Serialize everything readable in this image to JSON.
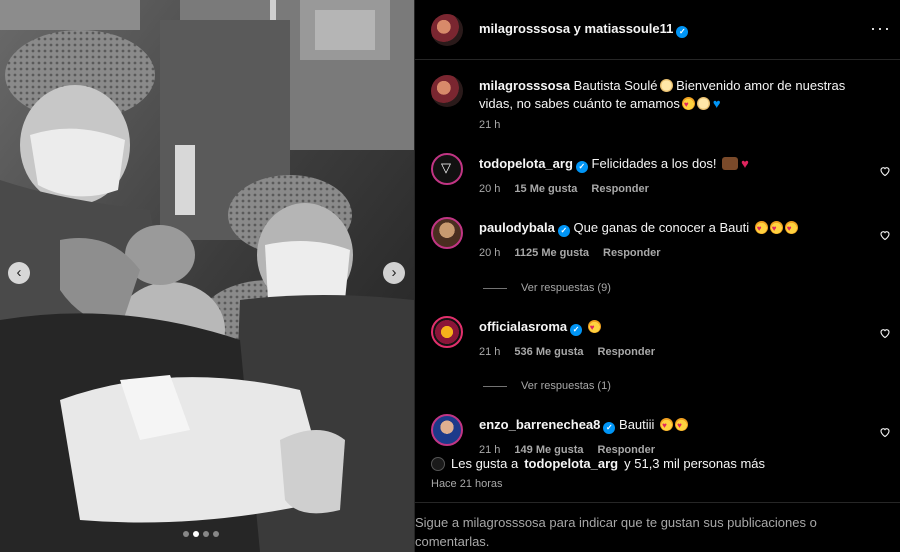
{
  "header": {
    "names": "milagrosssosa y matiassoule11"
  },
  "caption": {
    "user": "milagrosssosa",
    "text_a": "Bautista Soulé",
    "text_b": "Bienvenido amor de nuestras vidas, no sabes cuánto te amamos",
    "time": "21 h"
  },
  "comments": [
    {
      "user": "todopelota_arg",
      "text": "Felicidades a los dos!",
      "time": "20 h",
      "likes": "15 Me gusta",
      "reply": "Responder"
    },
    {
      "user": "paulodybala",
      "text": "Que ganas de conocer a Bauti",
      "time": "20 h",
      "likes": "1125 Me gusta",
      "reply": "Responder",
      "view_replies": "Ver respuestas (9)"
    },
    {
      "user": "officialasroma",
      "text": "",
      "time": "21 h",
      "likes": "536 Me gusta",
      "reply": "Responder",
      "view_replies": "Ver respuestas (1)"
    },
    {
      "user": "enzo_barrenechea8",
      "text": "Bautiii",
      "time": "21 h",
      "likes": "149 Me gusta",
      "reply": "Responder"
    }
  ],
  "likes_summary": {
    "prefix": "Les gusta a",
    "user": "todopelota_arg",
    "suffix": "y 51,3 mil personas más"
  },
  "time_ago": "Hace 21 horas",
  "footer": {
    "text": "Sigue a milagrosssosa para indicar que te gustan sus publicaciones o comentarlas."
  },
  "icons": {
    "more": "more-options-icon",
    "like": "heart-outline-icon",
    "verified": "verified-badge-icon",
    "prev": "chevron-left-icon",
    "next": "chevron-right-icon"
  },
  "colors": {
    "background": "#000000",
    "verified": "#0095f6",
    "secondary_text": "#a8a8a8"
  }
}
